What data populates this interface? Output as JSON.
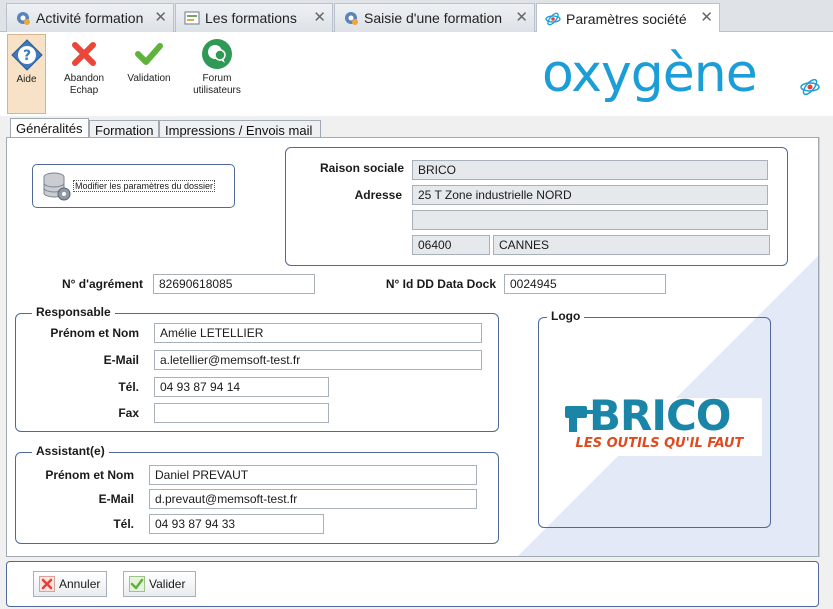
{
  "tabs": [
    {
      "label": "Activité formation",
      "icon": "gear-icon"
    },
    {
      "label": "Les formations",
      "icon": "form-icon"
    },
    {
      "label": "Saisie d'une formation",
      "icon": "gear-icon"
    },
    {
      "label": "Paramètres société",
      "icon": "atom-icon",
      "active": true
    }
  ],
  "toolbar": {
    "aide": "Aide",
    "abandon_line1": "Abandon",
    "abandon_line2": "Echap",
    "validation": "Validation",
    "forum_line1": "Forum",
    "forum_line2": "utilisateurs"
  },
  "brand": {
    "name": "oxygène",
    "color": "#1b9dd8"
  },
  "subtabs": [
    "Généralités",
    "Formation",
    "Impressions / Envois mail"
  ],
  "modify_button": "Modifier les paramètres du dossier",
  "company": {
    "raison_sociale_label": "Raison sociale",
    "raison_sociale": "BRICO",
    "adresse_label": "Adresse",
    "adresse1": "25 T Zone industrielle NORD",
    "adresse2": "",
    "code_postal": "06400",
    "ville": "CANNES"
  },
  "agrement": {
    "label": "N° d'agrément",
    "value": "82690618085"
  },
  "datadock": {
    "label": "N° Id DD Data Dock",
    "value": "0024945"
  },
  "responsable": {
    "title": "Responsable",
    "prenom_nom_label": "Prénom et Nom",
    "prenom_nom": "Amélie LETELLIER",
    "email_label": "E-Mail",
    "email": "a.letellier@memsoft-test.fr",
    "tel_label": "Tél.",
    "tel": "04 93 87 94 14",
    "fax_label": "Fax",
    "fax": ""
  },
  "assistant": {
    "title": "Assistant(e)",
    "prenom_nom_label": "Prénom et Nom",
    "prenom_nom": "Daniel PREVAUT",
    "email_label": "E-Mail",
    "email": "d.prevaut@memsoft-test.fr",
    "tel_label": "Tél.",
    "tel": "04 93 87 94 33"
  },
  "logo": {
    "title": "Logo",
    "brand_text": "BRICO",
    "slogan": "LES OUTILS QU'IL FAUT"
  },
  "bottom": {
    "annuler": "Annuler",
    "valider": "Valider"
  }
}
